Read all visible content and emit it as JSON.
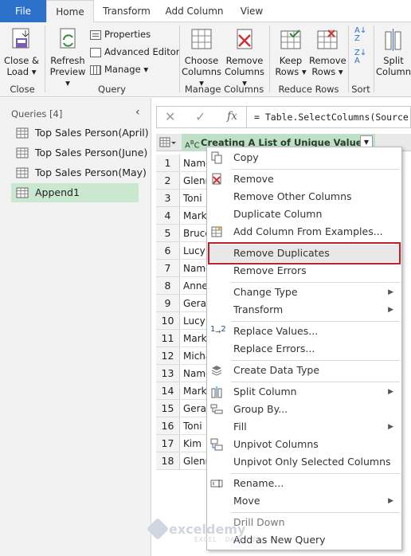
{
  "tabs": [
    "File",
    "Home",
    "Transform",
    "Add Column",
    "View"
  ],
  "ribbon": {
    "close_load": [
      "Close &",
      "Load"
    ],
    "refresh_preview": [
      "Refresh",
      "Preview"
    ],
    "properties": "Properties",
    "advanced_editor": "Advanced Editor",
    "manage": "Manage",
    "choose_columns": [
      "Choose",
      "Columns"
    ],
    "remove_columns": [
      "Remove",
      "Columns"
    ],
    "keep_rows": [
      "Keep",
      "Rows"
    ],
    "remove_rows": [
      "Remove",
      "Rows"
    ],
    "split_column": [
      "Split",
      "Column"
    ],
    "groups": {
      "close": "Close",
      "query": "Query",
      "manage_columns": "Manage Columns",
      "reduce_rows": "Reduce Rows",
      "sort": "Sort"
    }
  },
  "queries": {
    "header": "Queries [4]",
    "items": [
      "Top Sales Person(April)",
      "Top Sales Person(June)",
      "Top Sales Person(May)",
      "Append1"
    ],
    "selected": "Append1"
  },
  "formula": {
    "text": "= Table.SelectColumns(Source"
  },
  "grid": {
    "column_header": "Creating A List of Unique Values",
    "row_numbers": [
      "1",
      "2",
      "3",
      "4",
      "5",
      "6",
      "7",
      "8",
      "9",
      "10",
      "11",
      "12",
      "13",
      "14",
      "15",
      "16",
      "17",
      "18"
    ],
    "cells": [
      "Name",
      "Glenn",
      "Toni",
      "Mark",
      "Bruce",
      "Lucy",
      "Name",
      "Anne",
      "Geralt",
      "Lucy",
      "Mark",
      "Michael",
      "Name",
      "Mark",
      "Geralt",
      "Toni",
      "Kim",
      "Glenn"
    ]
  },
  "context_menu": {
    "copy": "Copy",
    "remove": "Remove",
    "remove_other": "Remove Other Columns",
    "duplicate": "Duplicate Column",
    "add_from_examples": "Add Column From Examples...",
    "remove_duplicates": "Remove Duplicates",
    "remove_errors": "Remove Errors",
    "change_type": "Change Type",
    "transform": "Transform",
    "replace_values": "Replace Values...",
    "replace_errors": "Replace Errors...",
    "create_data_type": "Create Data Type",
    "split_column": "Split Column",
    "group_by": "Group By...",
    "fill": "Fill",
    "unpivot_columns": "Unpivot Columns",
    "unpivot_selected": "Unpivot Only Selected Columns",
    "rename": "Rename...",
    "move": "Move",
    "drill_down": "Drill Down",
    "add_as_new_query": "Add as New Query"
  },
  "watermark": {
    "name": "exceldemy",
    "tagline": "EXCEL · DATA · BI"
  },
  "colors": {
    "file_tab": "#2b71c9",
    "selected_query": "#c9e8cf",
    "column_header": "#bfe0c6",
    "highlight": "#c0202a"
  }
}
